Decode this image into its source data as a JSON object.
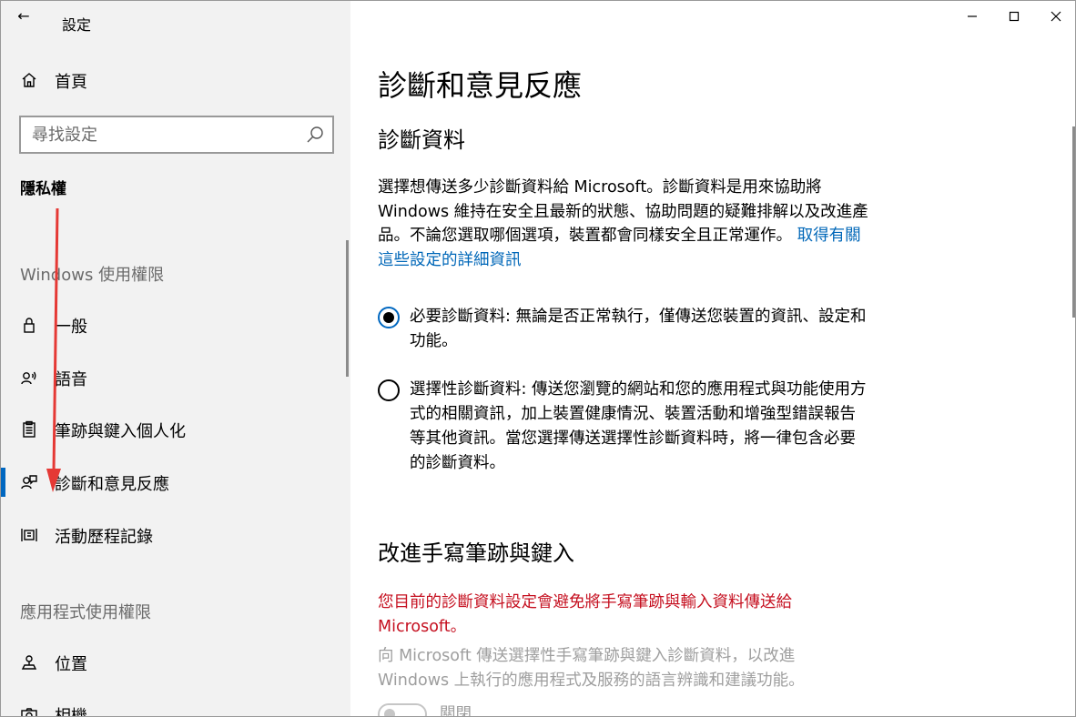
{
  "window": {
    "app_title": "設定",
    "back_glyph": "←",
    "controls": [
      "minimize-icon",
      "maximize-icon",
      "close-icon"
    ]
  },
  "sidebar": {
    "home_label": "首頁",
    "search_placeholder": "尋找設定",
    "section_title": "隱私權",
    "group1_label": "Windows 使用權限",
    "items": [
      {
        "label": "一般",
        "icon": "lock-icon"
      },
      {
        "label": "語音",
        "icon": "speech-icon"
      },
      {
        "label": "筆跡與鍵入個人化",
        "icon": "clipboard-icon"
      },
      {
        "label": "診斷和意見反應",
        "icon": "feedback-icon",
        "active": true
      },
      {
        "label": "活動歷程記錄",
        "icon": "timeline-icon"
      }
    ],
    "group2_label": "應用程式使用權限",
    "items2": [
      {
        "label": "位置",
        "icon": "location-icon"
      },
      {
        "label": "相機",
        "icon": "camera-icon"
      }
    ]
  },
  "main": {
    "page_title": "診斷和意見反應",
    "diag_heading": "診斷資料",
    "diag_desc": "選擇想傳送多少診斷資料給 Microsoft。診斷資料是用來協助將 Windows 維持在安全且最新的狀態、協助問題的疑難排解以及改進產品。不論您選取哪個選項，裝置都會同樣安全且正常運作。",
    "diag_link": "取得有關這些設定的詳細資訊",
    "radio_required": "必要診斷資料: 無論是否正常執行，僅傳送您裝置的資訊、設定和功能。",
    "radio_optional": "選擇性診斷資料: 傳送您瀏覽的網站和您的應用程式與功能使用方式的相關資訊，加上裝置健康情況、裝置活動和增強型錯誤報告等其他資訊。當您選擇傳送選擇性診斷資料時，將一律包含必要的診斷資料。",
    "inking_heading": "改進手寫筆跡與鍵入",
    "inking_warning": "您目前的診斷資料設定會避免將手寫筆跡與輸入資料傳送給 Microsoft。",
    "inking_desc": "向 Microsoft 傳送選擇性手寫筆跡與鍵入診斷資料，以改進 Windows 上執行的應用程式及服務的語言辨識和建議功能。",
    "toggle_label": "關閉"
  },
  "colors": {
    "accent": "#0067c0",
    "link": "#0067b8",
    "warning": "#c50f1f",
    "annotation_arrow": "#e53935"
  }
}
